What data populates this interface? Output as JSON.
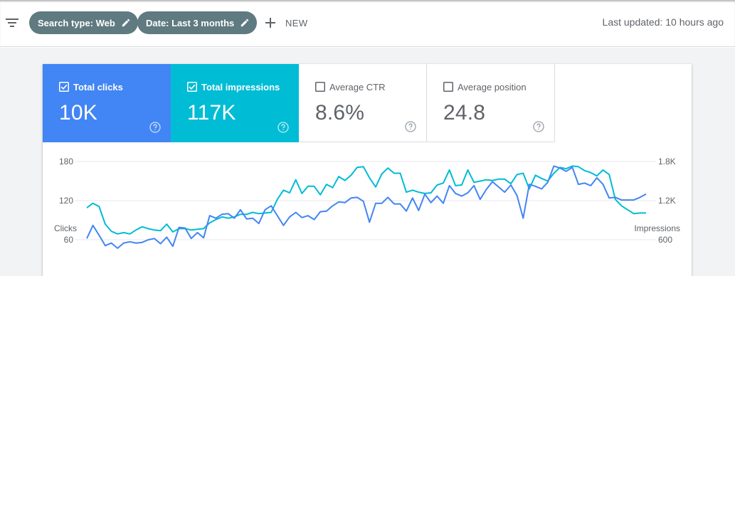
{
  "toolbar": {
    "filter_icon": "filter-list-icon",
    "chips": [
      {
        "label": "Search type: Web",
        "icon": "pencil-icon"
      },
      {
        "label": "Date: Last 3 months",
        "icon": "pencil-icon"
      }
    ],
    "new_label": "NEW",
    "new_icon": "plus-icon",
    "last_updated": "Last updated: 10 hours ago"
  },
  "metrics": [
    {
      "label": "Total clicks",
      "value": "10K",
      "checked": true,
      "color": "#4285f4"
    },
    {
      "label": "Total impressions",
      "value": "117K",
      "checked": true,
      "color": "#00bcd4"
    },
    {
      "label": "Average CTR",
      "value": "8.6%",
      "checked": false
    },
    {
      "label": "Average position",
      "value": "24.8",
      "checked": false
    }
  ],
  "colors": {
    "clicks": "#4285f4",
    "impressions": "#00bcd4",
    "chip": "#5f7a80",
    "grid": "#e8eaed",
    "text": "#5f6368"
  },
  "chart_data": {
    "type": "line",
    "left_axis": {
      "label": "Clicks",
      "ticks": [
        "180",
        "120",
        "60"
      ],
      "values": [
        180,
        120,
        60
      ]
    },
    "right_axis": {
      "label": "Impressions",
      "ticks": [
        "1.8K",
        "1.2K",
        "600"
      ],
      "values": [
        1800,
        1200,
        600
      ]
    },
    "ylim_left": [
      0,
      180
    ],
    "ylim_right": [
      0,
      1800
    ],
    "grid": true,
    "series": [
      {
        "axis": "left",
        "color": "#4285f4",
        "values": [
          62,
          82,
          67,
          51,
          55,
          47,
          55,
          57,
          55,
          56,
          60,
          62,
          54,
          64,
          50,
          79,
          78,
          62,
          71,
          63,
          97,
          93,
          99,
          100,
          93,
          106,
          92,
          93,
          85,
          106,
          112,
          97,
          82,
          95,
          102,
          94,
          97,
          91,
          103,
          104,
          112,
          118,
          117,
          124,
          125,
          119,
          87,
          116,
          116,
          125,
          115,
          115,
          104,
          124,
          105,
          130,
          117,
          127,
          116,
          143,
          131,
          127,
          132,
          143,
          122,
          137,
          149,
          141,
          133,
          144,
          128,
          93,
          145,
          142,
          138,
          148,
          173,
          170,
          165,
          171,
          145,
          147,
          143,
          155,
          145,
          124,
          125,
          121,
          121,
          121,
          125,
          130
        ]
      },
      {
        "axis": "right",
        "values": [
          1090,
          1160,
          1110,
          840,
          730,
          690,
          710,
          690,
          750,
          800,
          770,
          750,
          740,
          840,
          720,
          770,
          770,
          750,
          760,
          770,
          860,
          910,
          950,
          930,
          950,
          990,
          990,
          1020,
          1000,
          1010,
          1020,
          1220,
          1360,
          1320,
          1520,
          1310,
          1420,
          1420,
          1290,
          1450,
          1400,
          1570,
          1510,
          1590,
          1710,
          1720,
          1550,
          1410,
          1610,
          1700,
          1620,
          1620,
          1330,
          1360,
          1330,
          1310,
          1320,
          1440,
          1470,
          1670,
          1430,
          1440,
          1670,
          1480,
          1500,
          1520,
          1510,
          1530,
          1530,
          1460,
          1600,
          1620,
          1380,
          1590,
          1540,
          1500,
          1620,
          1710,
          1690,
          1730,
          1720,
          1660,
          1630,
          1580,
          1670,
          1600,
          1220,
          1120,
          1060,
          1000,
          1010,
          1010
        ]
      }
    ]
  }
}
